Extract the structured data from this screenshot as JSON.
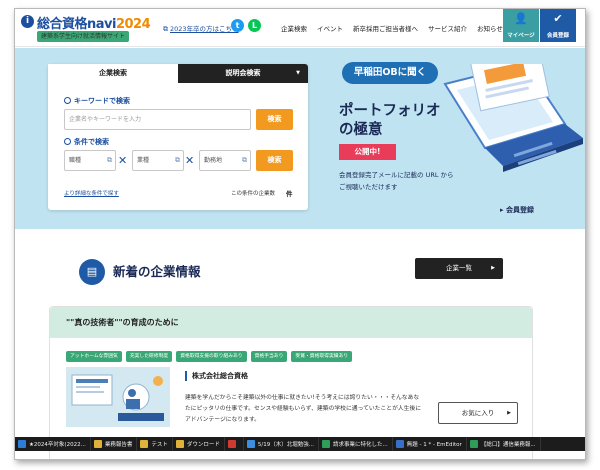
{
  "header": {
    "brand": "総合資格navi",
    "brand_year": "2024",
    "tagline": "建築系学生向け就活情報サイト",
    "prev_year_link": "2023年卒の方はこちら",
    "nav": [
      "企業検索",
      "イベント",
      "新卒採用ご担当者様へ",
      "サービス紹介",
      "お知らせ"
    ],
    "mypage_label": "マイページ",
    "register_label": "会員登録"
  },
  "search": {
    "tab_company": "企業検索",
    "tab_seminar": "説明会検索",
    "keyword_title": "キーワードで検索",
    "keyword_placeholder": "企業名やキーワードを入力",
    "search_button": "検索",
    "condition_title": "条件で検索",
    "select_job": "職種",
    "select_industry": "業種",
    "select_location": "勤務地",
    "detail_link": "より詳細な条件で探す",
    "count_label": "この条件の企業数",
    "count_unit": "件"
  },
  "banner": {
    "badge": "早稲田OBに聞く",
    "headline1": "ポートフォリオ",
    "headline2": "の極意",
    "published": "公開中!",
    "note1": "会員登録完了メールに記載の URL から",
    "note2": "ご視聴いただけます",
    "register": "会員登録"
  },
  "news": {
    "title": "新着の企業情報",
    "all_button": "企業一覧"
  },
  "card": {
    "heading": "\"\"真の技術者\"\"の育成のために",
    "tags": [
      "アットホームな雰囲気",
      "充実した研修制度",
      "資格取得支援の取り組みあり",
      "資格手当あり",
      "受賞・資格取得実績あり"
    ],
    "company": "株式会社総合資格",
    "desc1": "建築を学んだからこそ建築以外の仕事に就きたい!そう考えには誇りたい・・・そんなあな",
    "desc2": "たにピッタリの仕事です。センスや経験もいらず、建築の学校に通っていたことが人生後に",
    "desc3": "アドバンテージになります。",
    "fav_button": "お気に入り"
  },
  "taskbar": [
    "★2024卒対象(2022...",
    "業務報告書",
    "テスト",
    "ダウンロード",
    "",
    "5/19（木）北堀勉強...",
    "請求事業に特化した...",
    "無題 - 1 * - EmEditor",
    "【総口】通信業務報..."
  ],
  "colors": {
    "brand_blue": "#1d4fa0",
    "accent_orange": "#f29a1f",
    "hero_bg": "#bfe3f1",
    "tag_green": "#3aa876",
    "card_head_bg": "#d2ece2",
    "publish_red": "#e83c5a"
  }
}
